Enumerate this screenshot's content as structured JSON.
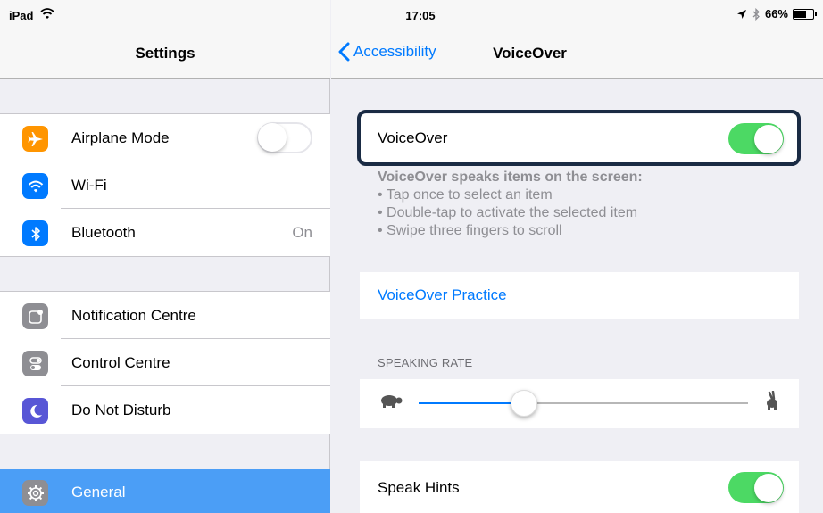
{
  "status_bar": {
    "carrier": "iPad",
    "time": "17:05",
    "battery": "66%",
    "battery_fraction": 0.66
  },
  "left_pane": {
    "title": "Settings",
    "groups": [
      {
        "items": [
          {
            "label": "Airplane Mode",
            "icon": "airplane-icon",
            "icon_color": "#ff9500",
            "toggle": false
          },
          {
            "label": "Wi-Fi",
            "icon": "wifi-icon",
            "icon_color": "#007aff"
          },
          {
            "label": "Bluetooth",
            "icon": "bluetooth-icon",
            "icon_color": "#007aff",
            "detail": "On"
          }
        ]
      },
      {
        "items": [
          {
            "label": "Notification Centre",
            "icon": "notification-centre-icon",
            "icon_color": "#8e8e93"
          },
          {
            "label": "Control Centre",
            "icon": "control-centre-icon",
            "icon_color": "#8e8e93"
          },
          {
            "label": "Do Not Disturb",
            "icon": "moon-icon",
            "icon_color": "#5856d6"
          }
        ]
      }
    ],
    "selected": {
      "label": "General",
      "icon": "gear-icon",
      "icon_color": "#8e8e93"
    }
  },
  "right_pane": {
    "back_label": "Accessibility",
    "title": "VoiceOver",
    "voiceover": {
      "label": "VoiceOver",
      "toggle": true
    },
    "description": {
      "heading": "VoiceOver speaks items on the screen:",
      "bullets": [
        "• Tap once to select an item",
        "• Double-tap to activate the selected item",
        "• Swipe three fingers to scroll"
      ]
    },
    "practice_label": "VoiceOver Practice",
    "speaking_rate": {
      "header": "SPEAKING RATE",
      "value_fraction": 0.32
    },
    "speak_hints": {
      "label": "Speak Hints",
      "toggle": true
    }
  },
  "colors": {
    "accent": "#007aff",
    "toggle_on": "#4cd964",
    "selected_row": "#4b9ef6",
    "highlight_border": "#1a2b44"
  }
}
